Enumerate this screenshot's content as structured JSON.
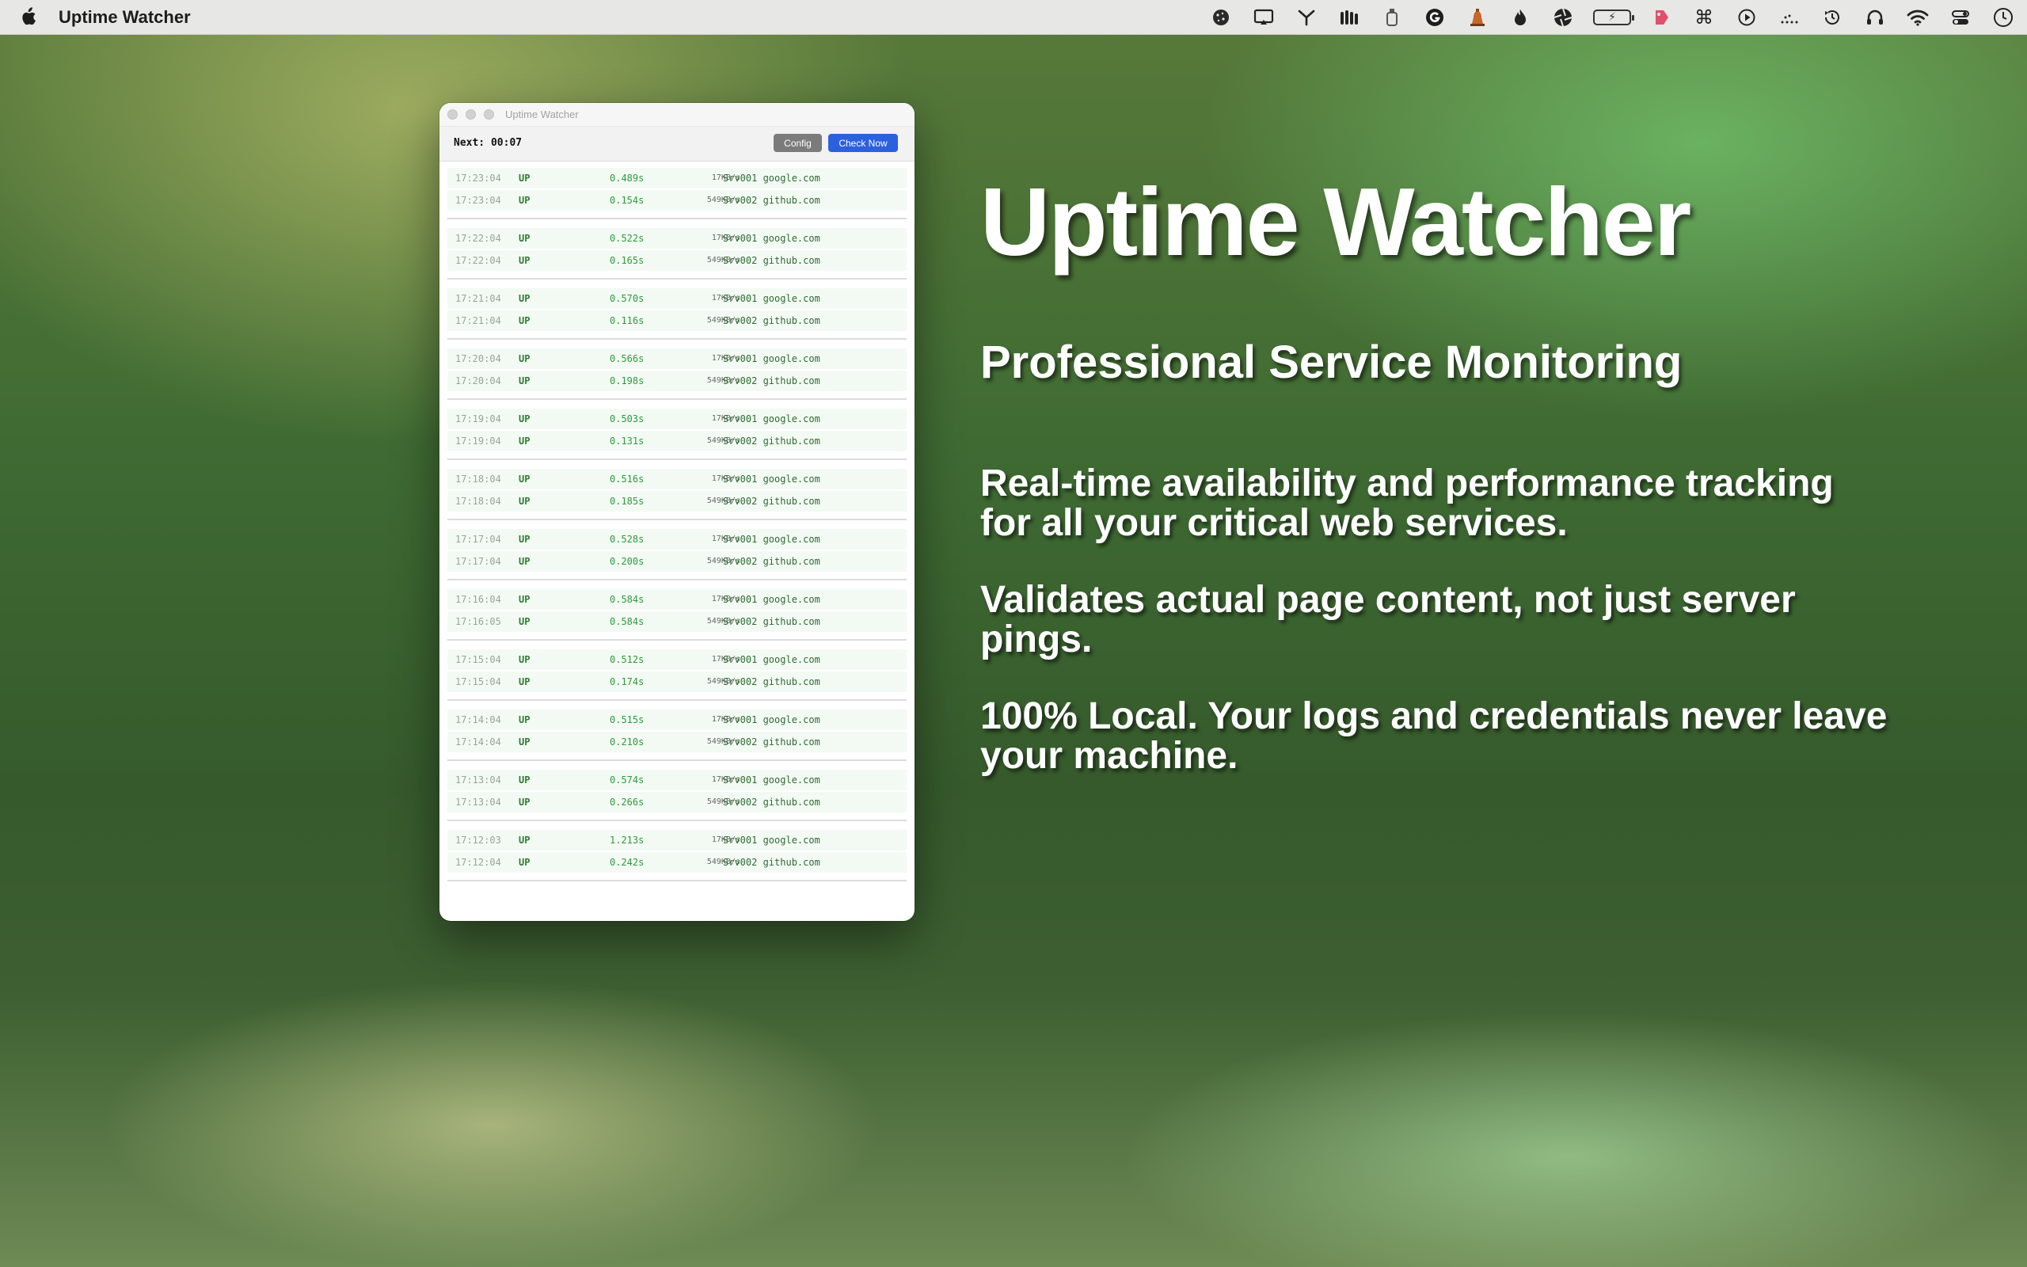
{
  "menubar": {
    "app_name": "Uptime Watcher",
    "status_icons": [
      "cookie-icon",
      "screen-mirror-icon",
      "branch-icon",
      "bars-icon",
      "bottle-icon",
      "grammarly-icon",
      "bell-icon",
      "flame-icon",
      "aperture-icon",
      "battery-icon",
      "tag-icon",
      "command-icon",
      "play-icon",
      "dots-icon",
      "history-icon",
      "headphones-icon",
      "wifi-icon",
      "control-center-icon",
      "clock-icon"
    ]
  },
  "window": {
    "title": "Uptime Watcher",
    "next_label": "Next: 00:07",
    "config_label": "Config",
    "check_now_label": "Check Now",
    "groups": [
      [
        {
          "time": "17:23:04",
          "status": "UP",
          "response": "0.489s",
          "speed": "17KB/s",
          "server": "Srv001 google.com"
        },
        {
          "time": "17:23:04",
          "status": "UP",
          "response": "0.154s",
          "speed": "549KB/s",
          "server": "Srv002 github.com"
        }
      ],
      [
        {
          "time": "17:22:04",
          "status": "UP",
          "response": "0.522s",
          "speed": "17KB/s",
          "server": "Srv001 google.com"
        },
        {
          "time": "17:22:04",
          "status": "UP",
          "response": "0.165s",
          "speed": "549KB/s",
          "server": "Srv002 github.com"
        }
      ],
      [
        {
          "time": "17:21:04",
          "status": "UP",
          "response": "0.570s",
          "speed": "17KB/s",
          "server": "Srv001 google.com"
        },
        {
          "time": "17:21:04",
          "status": "UP",
          "response": "0.116s",
          "speed": "549KB/s",
          "server": "Srv002 github.com"
        }
      ],
      [
        {
          "time": "17:20:04",
          "status": "UP",
          "response": "0.566s",
          "speed": "17KB/s",
          "server": "Srv001 google.com"
        },
        {
          "time": "17:20:04",
          "status": "UP",
          "response": "0.198s",
          "speed": "549KB/s",
          "server": "Srv002 github.com"
        }
      ],
      [
        {
          "time": "17:19:04",
          "status": "UP",
          "response": "0.503s",
          "speed": "17KB/s",
          "server": "Srv001 google.com"
        },
        {
          "time": "17:19:04",
          "status": "UP",
          "response": "0.131s",
          "speed": "549KB/s",
          "server": "Srv002 github.com"
        }
      ],
      [
        {
          "time": "17:18:04",
          "status": "UP",
          "response": "0.516s",
          "speed": "17KB/s",
          "server": "Srv001 google.com"
        },
        {
          "time": "17:18:04",
          "status": "UP",
          "response": "0.185s",
          "speed": "549KB/s",
          "server": "Srv002 github.com"
        }
      ],
      [
        {
          "time": "17:17:04",
          "status": "UP",
          "response": "0.528s",
          "speed": "17KB/s",
          "server": "Srv001 google.com"
        },
        {
          "time": "17:17:04",
          "status": "UP",
          "response": "0.200s",
          "speed": "549KB/s",
          "server": "Srv002 github.com"
        }
      ],
      [
        {
          "time": "17:16:04",
          "status": "UP",
          "response": "0.584s",
          "speed": "17KB/s",
          "server": "Srv001 google.com"
        },
        {
          "time": "17:16:05",
          "status": "UP",
          "response": "0.584s",
          "speed": "549KB/s",
          "server": "Srv002 github.com"
        }
      ],
      [
        {
          "time": "17:15:04",
          "status": "UP",
          "response": "0.512s",
          "speed": "17KB/s",
          "server": "Srv001 google.com"
        },
        {
          "time": "17:15:04",
          "status": "UP",
          "response": "0.174s",
          "speed": "549KB/s",
          "server": "Srv002 github.com"
        }
      ],
      [
        {
          "time": "17:14:04",
          "status": "UP",
          "response": "0.515s",
          "speed": "17KB/s",
          "server": "Srv001 google.com"
        },
        {
          "time": "17:14:04",
          "status": "UP",
          "response": "0.210s",
          "speed": "549KB/s",
          "server": "Srv002 github.com"
        }
      ],
      [
        {
          "time": "17:13:04",
          "status": "UP",
          "response": "0.574s",
          "speed": "17KB/s",
          "server": "Srv001 google.com"
        },
        {
          "time": "17:13:04",
          "status": "UP",
          "response": "0.266s",
          "speed": "549KB/s",
          "server": "Srv002 github.com"
        }
      ],
      [
        {
          "time": "17:12:03",
          "status": "UP",
          "response": "1.213s",
          "speed": "17KB/s",
          "server": "Srv001 google.com"
        },
        {
          "time": "17:12:04",
          "status": "UP",
          "response": "0.242s",
          "speed": "549KB/s",
          "server": "Srv002 github.com"
        }
      ]
    ]
  },
  "promo": {
    "title": "Uptime Watcher",
    "subtitle": "Professional Service Monitoring",
    "paragraph1": "Real-time availability and performance tracking for all your critical web services.",
    "paragraph2": "Validates actual page content, not just server pings.",
    "paragraph3": "100% Local. Your logs and credentials never leave your machine."
  },
  "colors": {
    "check_button": "#2b60de",
    "config_button": "#7b7b7b",
    "status_up": "#2e7d32",
    "row_background": "#f3faf3"
  }
}
